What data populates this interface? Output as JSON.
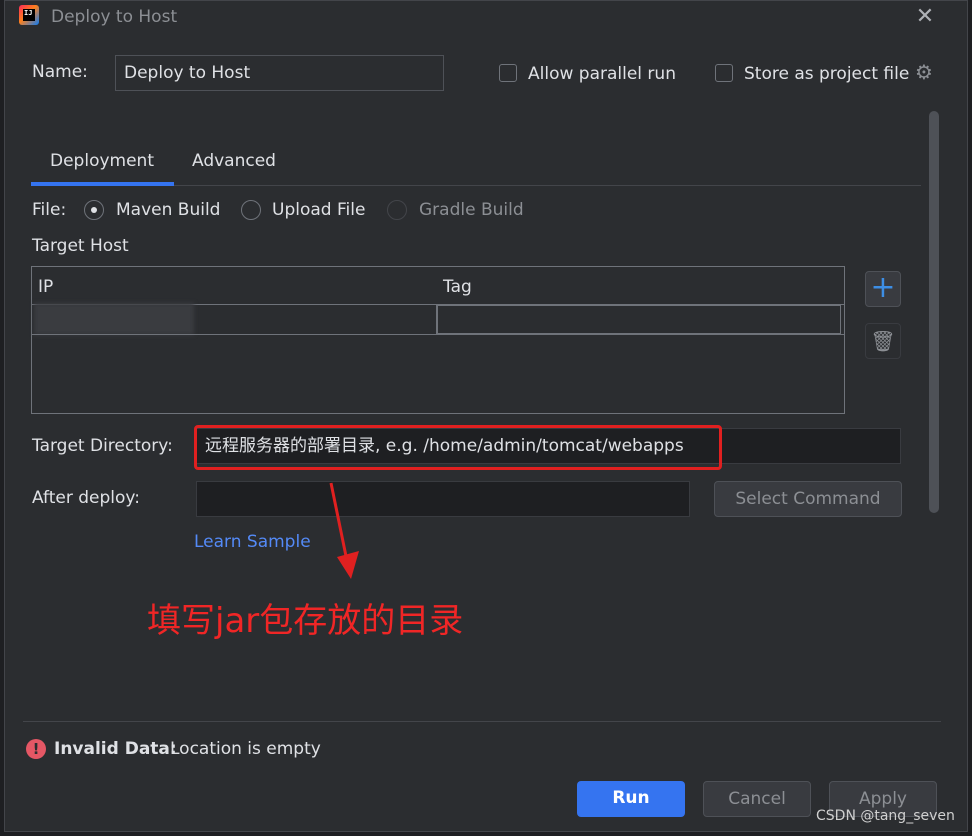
{
  "window": {
    "title": "Deploy to Host",
    "close_icon": "close-icon"
  },
  "name_row": {
    "label": "Name:",
    "value": "Deploy to Host",
    "allow_parallel_label": "Allow parallel run",
    "allow_parallel_checked": false,
    "store_project_label": "Store as project file",
    "store_project_checked": false
  },
  "tabs": [
    {
      "label": "Deployment",
      "selected": true
    },
    {
      "label": "Advanced",
      "selected": false
    }
  ],
  "file_row": {
    "label": "File:",
    "options": [
      {
        "label": "Maven Build",
        "checked": true,
        "enabled": true
      },
      {
        "label": "Upload File",
        "checked": false,
        "enabled": true
      },
      {
        "label": "Gradle Build",
        "checked": false,
        "enabled": false
      }
    ]
  },
  "target_host": {
    "label": "Target Host",
    "columns": [
      "IP",
      "Tag"
    ],
    "rows": [
      {
        "ip": "",
        "tag": ""
      }
    ]
  },
  "target_directory": {
    "label": "Target Directory:",
    "placeholder": "远程服务器的部署目录, e.g. /home/admin/tomcat/webapps"
  },
  "after_deploy": {
    "label": "After deploy:",
    "value": "",
    "select_command_label": "Select Command",
    "learn_sample_label": "Learn Sample"
  },
  "annotation": {
    "text": "填写jar包存放的目录",
    "color": "#f02626"
  },
  "status": {
    "icon": "error-icon",
    "bold": "Invalid Data:",
    "message": "Location is empty"
  },
  "buttons": {
    "run": "Run",
    "cancel": "Cancel",
    "apply": "Apply"
  },
  "watermark": "CSDN @tang_seven",
  "colors": {
    "accent": "#3574f0",
    "link": "#548af7",
    "error": "#e55765",
    "annotation_red": "#f02626"
  }
}
